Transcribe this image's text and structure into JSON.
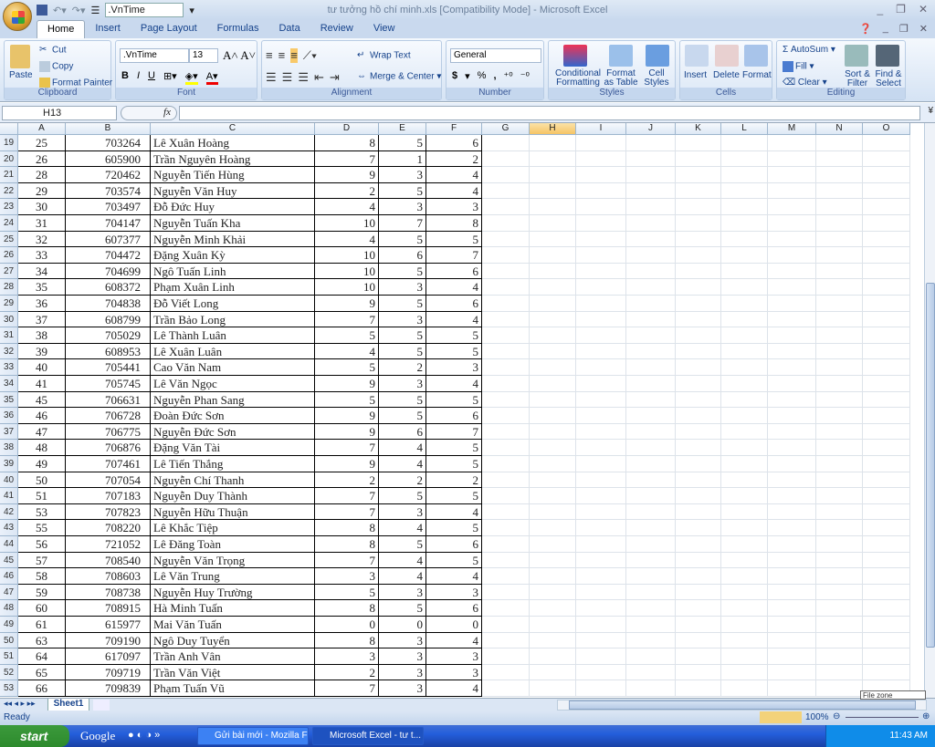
{
  "window": {
    "title": "tư tưởng hồ chí minh.xls  [Compatibility Mode] - Microsoft Excel",
    "qat_font": ".VnTime"
  },
  "tabs": [
    "Home",
    "Insert",
    "Page Layout",
    "Formulas",
    "Data",
    "Review",
    "View"
  ],
  "ribbon": {
    "clipboard": {
      "label": "Clipboard",
      "paste": "Paste",
      "cut": "Cut",
      "copy": "Copy",
      "format_painter": "Format Painter"
    },
    "font": {
      "label": "Font",
      "name": ".VnTime",
      "size": "13",
      "bold": "B",
      "italic": "I",
      "underline": "U"
    },
    "alignment": {
      "label": "Alignment",
      "wrap": "Wrap Text",
      "merge": "Merge & Center"
    },
    "number": {
      "label": "Number",
      "format": "General",
      "currency": "$",
      "percent": "%",
      "comma": ","
    },
    "styles": {
      "label": "Styles",
      "conditional": "Conditional Formatting",
      "format_table": "Format as Table",
      "cell_styles": "Cell Styles"
    },
    "cells": {
      "label": "Cells",
      "insert": "Insert",
      "delete": "Delete",
      "format": "Format"
    },
    "editing": {
      "label": "Editing",
      "autosum": "AutoSum",
      "fill": "Fill",
      "clear": "Clear",
      "sort": "Sort & Filter",
      "find": "Find & Select"
    }
  },
  "formula_bar": {
    "name_box": "H13",
    "fx": "fx",
    "value": ""
  },
  "columns": [
    "A",
    "B",
    "C",
    "D",
    "E",
    "F",
    "G",
    "H",
    "I",
    "J",
    "K",
    "L",
    "M",
    "N",
    "O"
  ],
  "selected_column": "H",
  "rows": [
    [
      "19",
      "25",
      "703264",
      "Lê Xuân Hoàng",
      "8",
      "5",
      "6"
    ],
    [
      "20",
      "26",
      "605900",
      "Trần Nguyên Hoàng",
      "7",
      "1",
      "2"
    ],
    [
      "21",
      "28",
      "720462",
      "Nguyễn Tiến Hùng",
      "9",
      "3",
      "4"
    ],
    [
      "22",
      "29",
      "703574",
      "Nguyễn Văn Huy",
      "2",
      "5",
      "4"
    ],
    [
      "23",
      "30",
      "703497",
      "Đỗ Đức Huy",
      "4",
      "3",
      "3"
    ],
    [
      "24",
      "31",
      "704147",
      "Nguyễn Tuấn Kha",
      "10",
      "7",
      "8"
    ],
    [
      "25",
      "32",
      "607377",
      "Nguyễn Minh Khải",
      "4",
      "5",
      "5"
    ],
    [
      "26",
      "33",
      "704472",
      "Đặng Xuân Kỳ",
      "10",
      "6",
      "7"
    ],
    [
      "27",
      "34",
      "704699",
      "Ngô Tuấn Linh",
      "10",
      "5",
      "6"
    ],
    [
      "28",
      "35",
      "608372",
      "Phạm Xuân Linh",
      "10",
      "3",
      "4"
    ],
    [
      "29",
      "36",
      "704838",
      "Đỗ Viết Long",
      "9",
      "5",
      "6"
    ],
    [
      "30",
      "37",
      "608799",
      "Trần Bảo Long",
      "7",
      "3",
      "4"
    ],
    [
      "31",
      "38",
      "705029",
      "Lê Thành Luân",
      "5",
      "5",
      "5"
    ],
    [
      "32",
      "39",
      "608953",
      "Lê Xuân Luân",
      "4",
      "5",
      "5"
    ],
    [
      "33",
      "40",
      "705441",
      "Cao Văn Nam",
      "5",
      "2",
      "3"
    ],
    [
      "34",
      "41",
      "705745",
      "Lê Văn Ngọc",
      "9",
      "3",
      "4"
    ],
    [
      "35",
      "45",
      "706631",
      "Nguyễn Phan Sang",
      "5",
      "5",
      "5"
    ],
    [
      "36",
      "46",
      "706728",
      "Đoàn Đức Sơn",
      "9",
      "5",
      "6"
    ],
    [
      "37",
      "47",
      "706775",
      "Nguyễn Đức Sơn",
      "9",
      "6",
      "7"
    ],
    [
      "38",
      "48",
      "706876",
      "Đặng Văn Tài",
      "7",
      "4",
      "5"
    ],
    [
      "39",
      "49",
      "707461",
      "Lê Tiến Thắng",
      "9",
      "4",
      "5"
    ],
    [
      "40",
      "50",
      "707054",
      "Nguyễn Chí Thanh",
      "2",
      "2",
      "2"
    ],
    [
      "41",
      "51",
      "707183",
      "Nguyễn Duy Thành",
      "7",
      "5",
      "5"
    ],
    [
      "42",
      "53",
      "707823",
      "Nguyễn Hữu Thuận",
      "7",
      "3",
      "4"
    ],
    [
      "43",
      "55",
      "708220",
      "Lê Khắc Tiệp",
      "8",
      "4",
      "5"
    ],
    [
      "44",
      "56",
      "721052",
      "Lê Đăng Toàn",
      "8",
      "5",
      "6"
    ],
    [
      "45",
      "57",
      "708540",
      "Nguyễn Văn Trọng",
      "7",
      "4",
      "5"
    ],
    [
      "46",
      "58",
      "708603",
      "Lê Văn Trung",
      "3",
      "4",
      "4"
    ],
    [
      "47",
      "59",
      "708738",
      "Nguyễn Huy Trường",
      "5",
      "3",
      "3"
    ],
    [
      "48",
      "60",
      "708915",
      "Hà Minh Tuấn",
      "8",
      "5",
      "6"
    ],
    [
      "49",
      "61",
      "615977",
      "Mai Văn Tuấn",
      "0",
      "0",
      "0"
    ],
    [
      "50",
      "63",
      "709190",
      "Ngô Duy Tuyển",
      "8",
      "3",
      "4"
    ],
    [
      "51",
      "64",
      "617097",
      "Trần Anh Vân",
      "3",
      "3",
      "3"
    ],
    [
      "52",
      "65",
      "709719",
      "Trần Văn Việt",
      "2",
      "3",
      "3"
    ],
    [
      "53",
      "66",
      "709839",
      "Phạm Tuấn Vũ",
      "7",
      "3",
      "4"
    ]
  ],
  "sheets": [
    "Sheet1"
  ],
  "status": {
    "ready": "Ready",
    "zoom": "100%"
  },
  "tooltip": "File zone",
  "taskbar": {
    "start": "start",
    "google": "Google",
    "tasks": [
      "Gửi bài mới - Mozilla Fi...",
      "Microsoft Excel - tư t..."
    ],
    "clock": "11:43 AM"
  }
}
